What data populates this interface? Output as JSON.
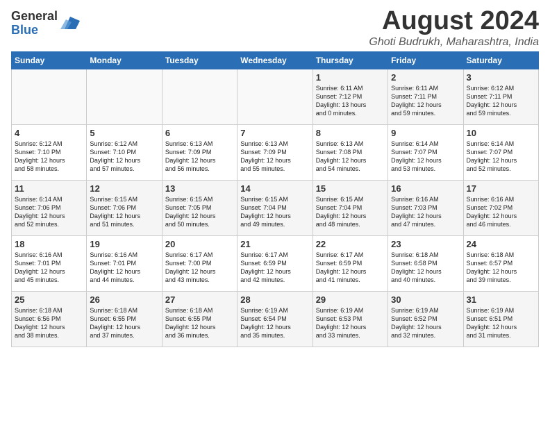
{
  "header": {
    "logo_general": "General",
    "logo_blue": "Blue",
    "title": "August 2024",
    "location": "Ghoti Budrukh, Maharashtra, India"
  },
  "weekdays": [
    "Sunday",
    "Monday",
    "Tuesday",
    "Wednesday",
    "Thursday",
    "Friday",
    "Saturday"
  ],
  "weeks": [
    [
      {
        "day": "",
        "content": ""
      },
      {
        "day": "",
        "content": ""
      },
      {
        "day": "",
        "content": ""
      },
      {
        "day": "",
        "content": ""
      },
      {
        "day": "1",
        "content": "Sunrise: 6:11 AM\nSunset: 7:12 PM\nDaylight: 13 hours\nand 0 minutes."
      },
      {
        "day": "2",
        "content": "Sunrise: 6:11 AM\nSunset: 7:11 PM\nDaylight: 12 hours\nand 59 minutes."
      },
      {
        "day": "3",
        "content": "Sunrise: 6:12 AM\nSunset: 7:11 PM\nDaylight: 12 hours\nand 59 minutes."
      }
    ],
    [
      {
        "day": "4",
        "content": "Sunrise: 6:12 AM\nSunset: 7:10 PM\nDaylight: 12 hours\nand 58 minutes."
      },
      {
        "day": "5",
        "content": "Sunrise: 6:12 AM\nSunset: 7:10 PM\nDaylight: 12 hours\nand 57 minutes."
      },
      {
        "day": "6",
        "content": "Sunrise: 6:13 AM\nSunset: 7:09 PM\nDaylight: 12 hours\nand 56 minutes."
      },
      {
        "day": "7",
        "content": "Sunrise: 6:13 AM\nSunset: 7:09 PM\nDaylight: 12 hours\nand 55 minutes."
      },
      {
        "day": "8",
        "content": "Sunrise: 6:13 AM\nSunset: 7:08 PM\nDaylight: 12 hours\nand 54 minutes."
      },
      {
        "day": "9",
        "content": "Sunrise: 6:14 AM\nSunset: 7:07 PM\nDaylight: 12 hours\nand 53 minutes."
      },
      {
        "day": "10",
        "content": "Sunrise: 6:14 AM\nSunset: 7:07 PM\nDaylight: 12 hours\nand 52 minutes."
      }
    ],
    [
      {
        "day": "11",
        "content": "Sunrise: 6:14 AM\nSunset: 7:06 PM\nDaylight: 12 hours\nand 52 minutes."
      },
      {
        "day": "12",
        "content": "Sunrise: 6:15 AM\nSunset: 7:06 PM\nDaylight: 12 hours\nand 51 minutes."
      },
      {
        "day": "13",
        "content": "Sunrise: 6:15 AM\nSunset: 7:05 PM\nDaylight: 12 hours\nand 50 minutes."
      },
      {
        "day": "14",
        "content": "Sunrise: 6:15 AM\nSunset: 7:04 PM\nDaylight: 12 hours\nand 49 minutes."
      },
      {
        "day": "15",
        "content": "Sunrise: 6:15 AM\nSunset: 7:04 PM\nDaylight: 12 hours\nand 48 minutes."
      },
      {
        "day": "16",
        "content": "Sunrise: 6:16 AM\nSunset: 7:03 PM\nDaylight: 12 hours\nand 47 minutes."
      },
      {
        "day": "17",
        "content": "Sunrise: 6:16 AM\nSunset: 7:02 PM\nDaylight: 12 hours\nand 46 minutes."
      }
    ],
    [
      {
        "day": "18",
        "content": "Sunrise: 6:16 AM\nSunset: 7:01 PM\nDaylight: 12 hours\nand 45 minutes."
      },
      {
        "day": "19",
        "content": "Sunrise: 6:16 AM\nSunset: 7:01 PM\nDaylight: 12 hours\nand 44 minutes."
      },
      {
        "day": "20",
        "content": "Sunrise: 6:17 AM\nSunset: 7:00 PM\nDaylight: 12 hours\nand 43 minutes."
      },
      {
        "day": "21",
        "content": "Sunrise: 6:17 AM\nSunset: 6:59 PM\nDaylight: 12 hours\nand 42 minutes."
      },
      {
        "day": "22",
        "content": "Sunrise: 6:17 AM\nSunset: 6:59 PM\nDaylight: 12 hours\nand 41 minutes."
      },
      {
        "day": "23",
        "content": "Sunrise: 6:18 AM\nSunset: 6:58 PM\nDaylight: 12 hours\nand 40 minutes."
      },
      {
        "day": "24",
        "content": "Sunrise: 6:18 AM\nSunset: 6:57 PM\nDaylight: 12 hours\nand 39 minutes."
      }
    ],
    [
      {
        "day": "25",
        "content": "Sunrise: 6:18 AM\nSunset: 6:56 PM\nDaylight: 12 hours\nand 38 minutes."
      },
      {
        "day": "26",
        "content": "Sunrise: 6:18 AM\nSunset: 6:55 PM\nDaylight: 12 hours\nand 37 minutes."
      },
      {
        "day": "27",
        "content": "Sunrise: 6:18 AM\nSunset: 6:55 PM\nDaylight: 12 hours\nand 36 minutes."
      },
      {
        "day": "28",
        "content": "Sunrise: 6:19 AM\nSunset: 6:54 PM\nDaylight: 12 hours\nand 35 minutes."
      },
      {
        "day": "29",
        "content": "Sunrise: 6:19 AM\nSunset: 6:53 PM\nDaylight: 12 hours\nand 33 minutes."
      },
      {
        "day": "30",
        "content": "Sunrise: 6:19 AM\nSunset: 6:52 PM\nDaylight: 12 hours\nand 32 minutes."
      },
      {
        "day": "31",
        "content": "Sunrise: 6:19 AM\nSunset: 6:51 PM\nDaylight: 12 hours\nand 31 minutes."
      }
    ]
  ]
}
